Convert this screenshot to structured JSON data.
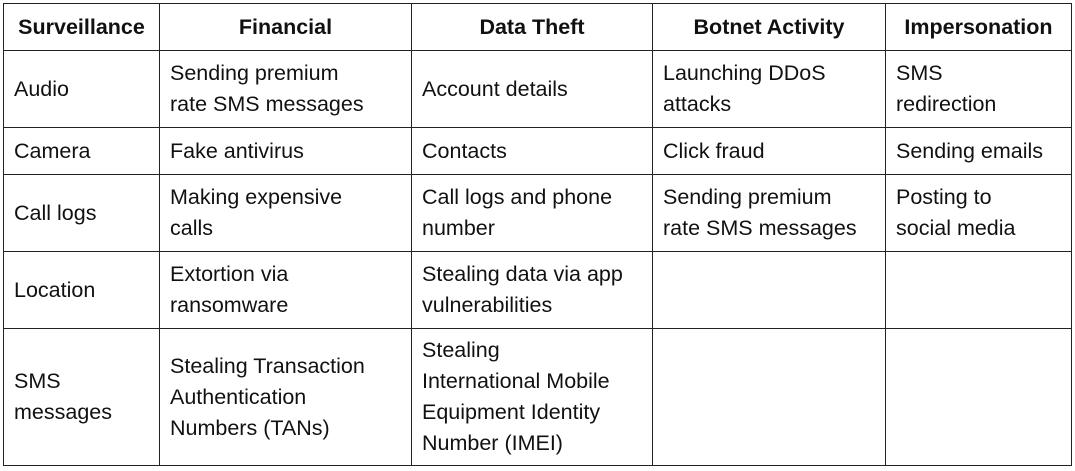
{
  "table": {
    "headers": [
      "Surveillance",
      "Financial",
      "Data Theft",
      "Botnet Activity",
      "Impersonation"
    ],
    "rows": [
      [
        "Audio",
        "Sending premium\nrate SMS messages",
        "Account details",
        "Launching DDoS\nattacks",
        "SMS\nredirection"
      ],
      [
        "Camera",
        "Fake antivirus",
        "Contacts",
        "Click fraud",
        "Sending emails"
      ],
      [
        "Call logs",
        "Making expensive\ncalls",
        "Call logs and phone\nnumber",
        "Sending premium\nrate SMS messages",
        "Posting to\nsocial media"
      ],
      [
        "Location",
        "Extortion via\nransomware",
        "Stealing data via app\nvulnerabilities",
        "",
        ""
      ],
      [
        "SMS\nmessages",
        "Stealing Transaction\nAuthentication\nNumbers (TANs)",
        "Stealing\nInternational Mobile\nEquipment Identity\nNumber (IMEI)",
        "",
        ""
      ]
    ]
  }
}
